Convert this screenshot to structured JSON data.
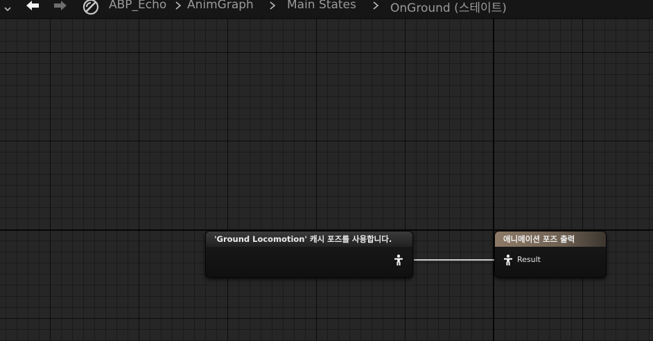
{
  "breadcrumb": {
    "asset": "ABP_Echo",
    "items": [
      "AnimGraph",
      "Main States",
      "OnGround (스테이트)"
    ]
  },
  "nodes": {
    "cache": {
      "title": "'Ground Locomotion' 캐시 포즈를 사용합니다."
    },
    "output": {
      "title": "애니메이션 포즈 출력",
      "pin_label": "Result"
    }
  },
  "colors": {
    "background": "#262626",
    "output_header": "#8d7a66",
    "wire": "#cfcfcf"
  },
  "icons": [
    "chevron-down-icon",
    "back-arrow-icon",
    "forward-arrow-icon",
    "blueprint-icon",
    "pose-pin-icon"
  ]
}
